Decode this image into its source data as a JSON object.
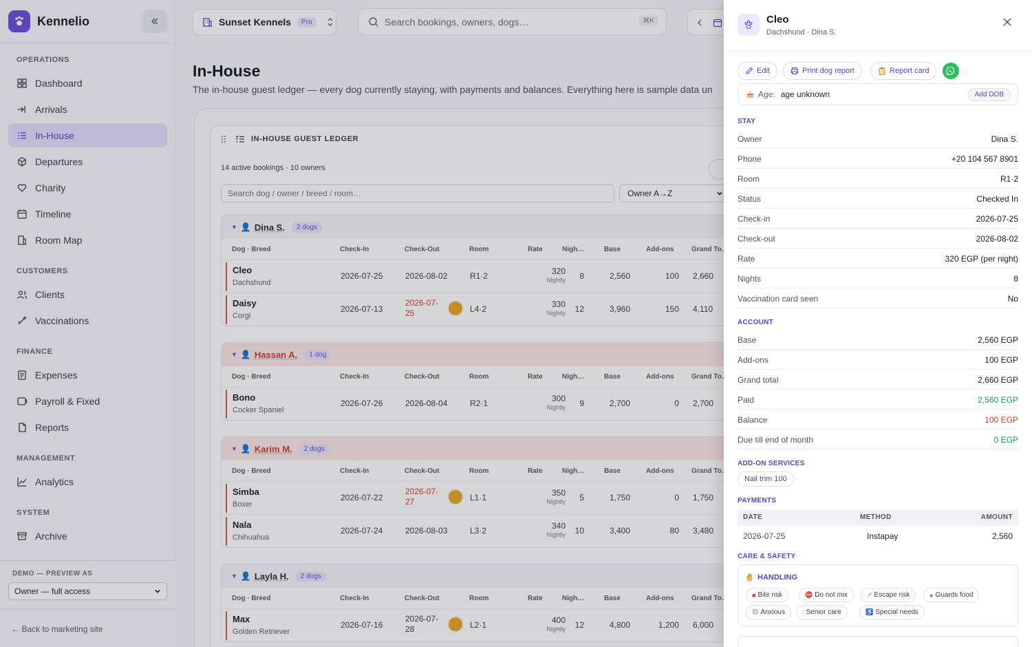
{
  "app": {
    "name": "Kennelio"
  },
  "sidebar": {
    "sections": [
      {
        "label": "OPERATIONS",
        "items": [
          {
            "label": "Dashboard",
            "icon": "dashboard-icon"
          },
          {
            "label": "Arrivals",
            "icon": "arrivals-icon"
          },
          {
            "label": "In-House",
            "icon": "in-house-icon",
            "active": true
          },
          {
            "label": "Departures",
            "icon": "departures-icon"
          },
          {
            "label": "Charity",
            "icon": "charity-icon"
          },
          {
            "label": "Timeline",
            "icon": "timeline-icon"
          },
          {
            "label": "Room Map",
            "icon": "room-map-icon"
          }
        ]
      },
      {
        "label": "CUSTOMERS",
        "items": [
          {
            "label": "Clients",
            "icon": "clients-icon"
          },
          {
            "label": "Vaccinations",
            "icon": "vaccinations-icon"
          }
        ]
      },
      {
        "label": "FINANCE",
        "items": [
          {
            "label": "Expenses",
            "icon": "expenses-icon"
          },
          {
            "label": "Payroll & Fixed",
            "icon": "payroll-icon"
          },
          {
            "label": "Reports",
            "icon": "reports-icon"
          }
        ]
      },
      {
        "label": "MANAGEMENT",
        "items": [
          {
            "label": "Analytics",
            "icon": "analytics-icon"
          }
        ]
      },
      {
        "label": "SYSTEM",
        "items": [
          {
            "label": "Archive",
            "icon": "archive-icon"
          }
        ]
      }
    ],
    "demo": {
      "label": "DEMO — PREVIEW AS",
      "selected": "Owner — full access"
    },
    "back_link": "← Back to marketing site"
  },
  "topbar": {
    "kennel": "Sunset Kennels",
    "plan": "Pro",
    "search_placeholder": "Search bookings, owners, dogs…",
    "search_shortcut": "⌘K"
  },
  "page": {
    "title": "In-House",
    "description": "The in-house guest ledger — every dog currently staying, with payments and balances. Everything here is sample data un"
  },
  "ledger": {
    "title": "IN-HOUSE GUEST LEDGER",
    "summary": "14 active bookings · 10 owners",
    "search_placeholder": "Search dog / owner / breed / room…",
    "sort": "Owner A→Z",
    "columns": [
      "Dog · Breed",
      "Check-In",
      "Check-Out",
      "Room",
      "Rate",
      "Nigh…",
      "Base",
      "Add-ons",
      "Grand To…"
    ],
    "groups": [
      {
        "owner": "Dina S.",
        "dogs_label": "2 dogs",
        "owed": false,
        "rows": [
          {
            "dog": "Cleo",
            "breed": "Dachshund",
            "check_in": "2026-07-25",
            "check_out": "2026-08-02",
            "check_out_late": false,
            "whatsapp": false,
            "room": "R1·2",
            "rate": "320",
            "rate_unit": "Nightly",
            "nights": "8",
            "base": "2,560",
            "addons": "100",
            "grand": "2,660"
          },
          {
            "dog": "Daisy",
            "breed": "Corgi",
            "check_in": "2026-07-13",
            "check_out": "2026-07-25",
            "check_out_late": true,
            "whatsapp": true,
            "room": "L4·2",
            "rate": "330",
            "rate_unit": "Nightly",
            "nights": "12",
            "base": "3,960",
            "addons": "150",
            "grand": "4,110"
          }
        ]
      },
      {
        "owner": "Hassan A.",
        "dogs_label": "1 dog",
        "owed": true,
        "rows": [
          {
            "dog": "Bono",
            "breed": "Cocker Spaniel",
            "check_in": "2026-07-26",
            "check_out": "2026-08-04",
            "check_out_late": false,
            "whatsapp": false,
            "room": "R2·1",
            "rate": "300",
            "rate_unit": "Nightly",
            "nights": "9",
            "base": "2,700",
            "addons": "0",
            "grand": "2,700"
          }
        ]
      },
      {
        "owner": "Karim M.",
        "dogs_label": "2 dogs",
        "owed": true,
        "rows": [
          {
            "dog": "Simba",
            "breed": "Boxer",
            "check_in": "2026-07-22",
            "check_out": "2026-07-27",
            "check_out_late": true,
            "whatsapp": true,
            "room": "L1·1",
            "rate": "350",
            "rate_unit": "Nightly",
            "nights": "5",
            "base": "1,750",
            "addons": "0",
            "grand": "1,750"
          },
          {
            "dog": "Nala",
            "breed": "Chihuahua",
            "check_in": "2026-07-24",
            "check_out": "2026-08-03",
            "check_out_late": false,
            "whatsapp": false,
            "room": "L3·2",
            "rate": "340",
            "rate_unit": "Nightly",
            "nights": "10",
            "base": "3,400",
            "addons": "80",
            "grand": "3,480"
          }
        ]
      },
      {
        "owner": "Layla H.",
        "dogs_label": "2 dogs",
        "owed": false,
        "rows": [
          {
            "dog": "Max",
            "breed": "Golden Retriever",
            "check_in": "2026-07-16",
            "check_out": "2026-07-28",
            "check_out_late": false,
            "whatsapp": true,
            "room": "L2·1",
            "rate": "400",
            "rate_unit": "Nightly",
            "nights": "12",
            "base": "4,800",
            "addons": "1,200",
            "grand": "6,000"
          }
        ]
      }
    ]
  },
  "drawer": {
    "name": "Cleo",
    "subtitle": "Dachshund · Dina S.",
    "actions": {
      "edit": "Edit",
      "print": "Print dog report",
      "report_card": "Report card"
    },
    "age_label": "Age:",
    "age_value": "age unknown",
    "add_dob": "Add DOB",
    "stay_title": "STAY",
    "stay": [
      {
        "k": "Owner",
        "v": "Dina S."
      },
      {
        "k": "Phone",
        "v": "+20 104 567 8901"
      },
      {
        "k": "Room",
        "v": "R1·2"
      },
      {
        "k": "Status",
        "v": "Checked In"
      },
      {
        "k": "Check-in",
        "v": "2026-07-25"
      },
      {
        "k": "Check-out",
        "v": "2026-08-02"
      },
      {
        "k": "Rate",
        "v": "320 EGP (per night)"
      },
      {
        "k": "Nights",
        "v": "8"
      },
      {
        "k": "Vaccination card seen",
        "v": "No"
      }
    ],
    "account_title": "ACCOUNT",
    "account": [
      {
        "k": "Base",
        "v": "2,560 EGP",
        "tone": ""
      },
      {
        "k": "Add-ons",
        "v": "100 EGP",
        "tone": ""
      },
      {
        "k": "Grand total",
        "v": "2,660 EGP",
        "tone": ""
      },
      {
        "k": "Paid",
        "v": "2,560 EGP",
        "tone": "green"
      },
      {
        "k": "Balance",
        "v": "100 EGP",
        "tone": "red"
      },
      {
        "k": "Due till end of month",
        "v": "0 EGP",
        "tone": "green"
      }
    ],
    "addons_title": "ADD-ON SERVICES",
    "addon_chip": "Nail trim 100",
    "payments_title": "PAYMENTS",
    "payments_head": {
      "date": "DATE",
      "method": "METHOD",
      "amount": "AMOUNT"
    },
    "payment": {
      "date": "2026-07-25",
      "method": "Instapay",
      "amount": "2,560"
    },
    "care_title": "CARE & SAFETY",
    "handling_title": "HANDLING",
    "tags": [
      "Bite risk",
      "Do not mix",
      "Escape risk",
      "Guards food",
      "Anxious",
      "Senior care",
      "Special needs"
    ]
  },
  "colors": {
    "accent": "#6a4fd8",
    "danger": "#d33b2c",
    "success": "#1aa04a",
    "whatsapp": "#25c15a"
  }
}
